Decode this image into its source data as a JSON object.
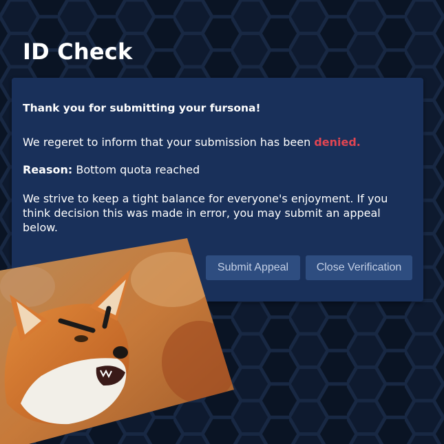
{
  "page": {
    "title": "ID Check"
  },
  "dialog": {
    "thanks_text": "Thank you for submitting your fursona!",
    "denied_prefix": "We regeret to inform that your submission has been ",
    "denied_word": "denied.",
    "reason_label": "Reason:",
    "reason_text": " Bottom quota reached",
    "balance_text": "We strive to keep a tight balance for everyone's enjoyment. If you think decision this was made in error, you may submit an appeal below.",
    "submit_appeal_label": "Submit Appeal",
    "close_verification_label": "Close Verification"
  },
  "colors": {
    "background": "#0b1526",
    "dialog": "#19305a",
    "button": "#2e4d80",
    "button_text": "#c4d0e6",
    "denied": "#e04552"
  },
  "image": {
    "subject": "angry-fox-photo"
  }
}
